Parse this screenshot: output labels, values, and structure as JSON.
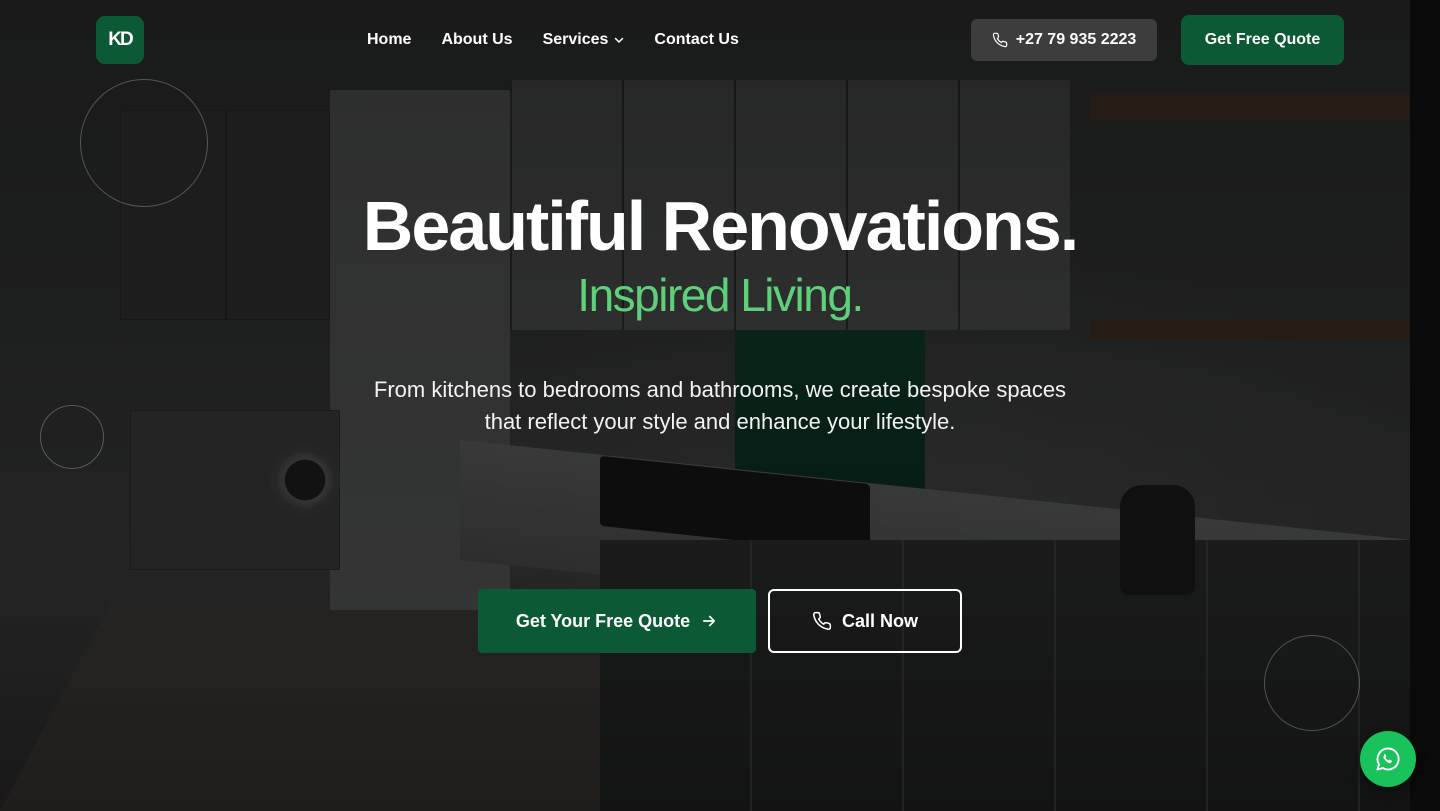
{
  "brand": {
    "logo_text": "KD",
    "accent": "#0b5a35",
    "highlight": "#5fd07a",
    "whatsapp_color": "#19c25a"
  },
  "nav": {
    "links": [
      {
        "label": "Home"
      },
      {
        "label": "About Us"
      },
      {
        "label": "Services",
        "has_dropdown": true,
        "icon": "chevron-down-icon"
      },
      {
        "label": "Contact Us"
      }
    ],
    "phone": {
      "label": "+27 79 935 2223",
      "icon": "phone-icon"
    },
    "quote_button": "Get Free Quote"
  },
  "hero": {
    "title": "Beautiful Renovations.",
    "subtitle": "Inspired Living.",
    "description_line1": "From kitchens to bedrooms and bathrooms, we create bespoke spaces",
    "description_line2": "that reflect your style and enhance your lifestyle.",
    "primary_cta": {
      "label": "Get Your Free Quote",
      "icon": "arrow-right-icon"
    },
    "secondary_cta": {
      "label": "Call Now",
      "icon": "phone-icon"
    }
  },
  "floating": {
    "whatsapp_icon": "whatsapp-icon"
  }
}
